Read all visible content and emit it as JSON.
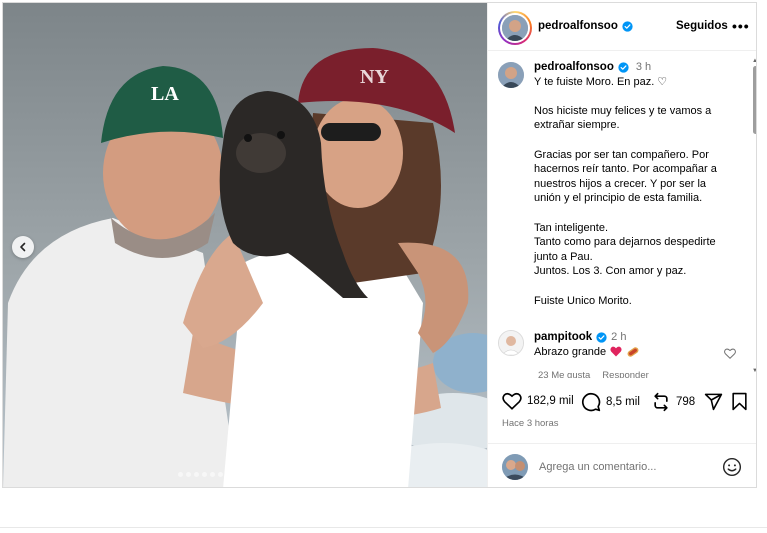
{
  "post": {
    "author": {
      "username": "pedroalfonsoo",
      "verified": true,
      "follow_label": "Seguidos",
      "more_label": "•••"
    },
    "photo": {
      "carousel_count": 17,
      "active_index": 16
    },
    "caption": {
      "username": "pedroalfonsoo",
      "time": "3 h",
      "paragraphs": [
        [
          "Y te fuiste Moro. En paz. ♡"
        ],
        [
          "Nos hiciste muy felices y te vamos a",
          "extrañar siempre."
        ],
        [
          "Gracias por ser tan compañero. Por",
          "hacernos reír tanto. Por acompañar a",
          "nuestros hijos a crecer. Y por ser la",
          "unión y el principio de esta familia."
        ],
        [
          "Tan inteligente.",
          "Tanto como para dejarnos despedirte",
          "junto a Pau.",
          "Juntos. Los 3. Con amor y paz."
        ],
        [
          "Fuiste Unico Morito."
        ]
      ]
    },
    "top_comment": {
      "username": "pampitook",
      "verified": true,
      "time": "2 h",
      "text": "Abrazo grande",
      "likes": "23 Me gusta",
      "reply_label": "Responder"
    },
    "stats": {
      "likes": "182,9 mil",
      "comments": "8,5 mil",
      "reposts": "798"
    },
    "date": "Hace 3 horas",
    "add_comment": {
      "placeholder": "Agrega un comentario..."
    }
  },
  "colors": {
    "verified_blue": "#0095f6",
    "secondary_text": "#737373",
    "heart_red": "#e0245e"
  },
  "icons": [
    "chevron-left-icon",
    "verified-icon",
    "heart-icon",
    "comment-icon",
    "repost-icon",
    "share-icon",
    "bookmark-icon",
    "emoji-icon"
  ]
}
